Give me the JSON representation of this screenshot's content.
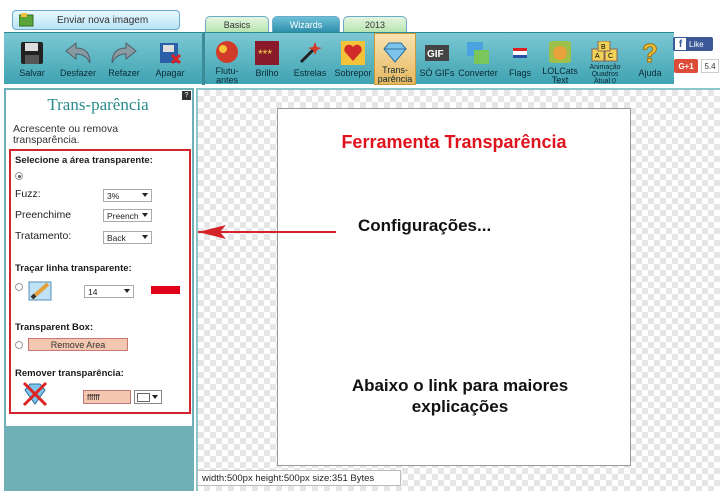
{
  "upload": {
    "label": "Enviar nova imagem"
  },
  "tabs": [
    {
      "label": "Basics",
      "active": false
    },
    {
      "label": "Wizards",
      "active": true
    },
    {
      "label": "2013",
      "active": false
    }
  ],
  "toolbar": {
    "left": [
      {
        "label": "Salvar",
        "icon": "floppy-disk-icon"
      },
      {
        "label": "Desfazer",
        "icon": "undo-arrow-icon"
      },
      {
        "label": "Refazer",
        "icon": "redo-arrow-icon"
      },
      {
        "label": "Apagar",
        "icon": "delete-icon"
      }
    ],
    "right": [
      {
        "label": "Flutu-\nantes",
        "icon": "floaters-icon"
      },
      {
        "label": "Brilho",
        "icon": "glitter-icon"
      },
      {
        "label": "Estrelas",
        "icon": "stars-wand-icon"
      },
      {
        "label": "Sobrepor",
        "icon": "overlay-heart-icon"
      },
      {
        "label": "Trans-\nparência",
        "icon": "diamond-icon",
        "active": true
      },
      {
        "label": "SÓ GIFs",
        "icon": "gif-icon"
      },
      {
        "label": "Converter",
        "icon": "convert-icon"
      },
      {
        "label": "Flags",
        "icon": "flag-icon"
      },
      {
        "label": "LOLCats\nText",
        "icon": "lolcat-icon"
      },
      {
        "label": "Animação\nQuadros\nAtual 0",
        "icon": "abc-blocks-icon"
      },
      {
        "label": "Ajuda",
        "icon": "question-mark-icon"
      }
    ]
  },
  "social": {
    "fb_label": "Like",
    "gplus_label": "G+1",
    "gplus_count": "5.4"
  },
  "panel": {
    "title": "Trans-parência",
    "description": "Acrescente ou remova transparência.",
    "help": "?",
    "select_area": {
      "title": "Selecione a área transparente:",
      "fuzz_label": "Fuzz:",
      "fuzz_value": "3%",
      "fill_label": "Preenchime",
      "fill_value": "Preench",
      "treatment_label": "Tratamento:",
      "treatment_value": "Back"
    },
    "trace_line": {
      "title": "Traçar linha transparente:",
      "width_value": "14",
      "color": "#e0001a"
    },
    "transparent_box": {
      "title": "Transparent Box:",
      "button": "Remove Area"
    },
    "remove_transparency": {
      "title": "Remover transparência:",
      "hex_value": "ffffff"
    }
  },
  "canvas": {
    "heading": "Ferramenta Transparência",
    "config_note": "Configurações...",
    "link_note": "Abaixo o link para maiores explicações",
    "status": "width:500px  height:500px  size:351 Bytes"
  }
}
